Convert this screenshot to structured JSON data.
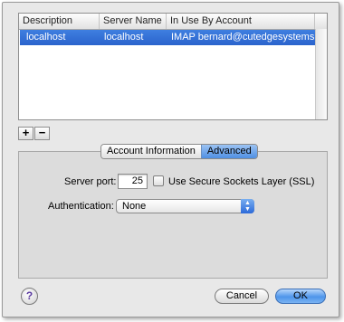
{
  "table": {
    "columns": [
      "Description",
      "Server Name",
      "In Use By Account"
    ],
    "rows": [
      {
        "description": "localhost",
        "server_name": "localhost",
        "in_use_by": "IMAP bernard@cutedgesystems..."
      }
    ]
  },
  "list_buttons": {
    "add": "+",
    "remove": "−"
  },
  "tabs": [
    "Account Information",
    "Advanced"
  ],
  "selected_tab": "Advanced",
  "advanced": {
    "server_port_label": "Server port:",
    "server_port_value": "25",
    "ssl_label": "Use Secure Sockets Layer (SSL)",
    "ssl_checked": false,
    "auth_label": "Authentication:",
    "auth_value": "None"
  },
  "footer": {
    "help": "?",
    "cancel": "Cancel",
    "ok": "OK"
  },
  "colors": {
    "selection": "#2f6ed6",
    "default_button": "#4e95ea"
  }
}
